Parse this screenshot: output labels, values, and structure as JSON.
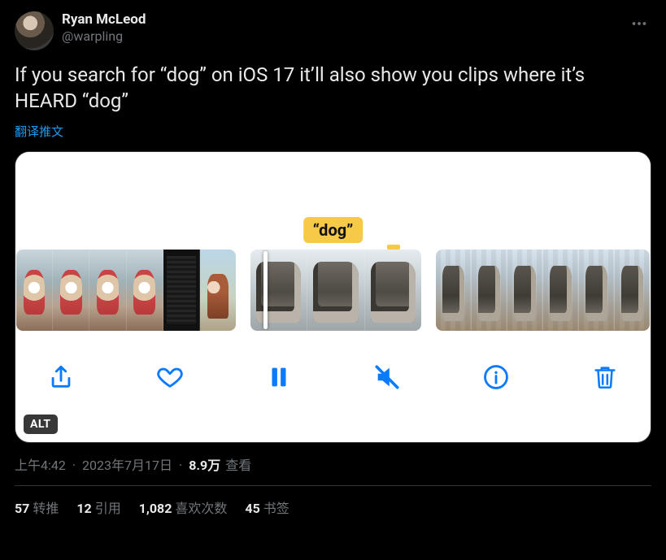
{
  "author": {
    "display_name": "Ryan McLeod",
    "handle": "@warpling"
  },
  "tweet_text": "If you search for “dog” on iOS 17 it’ll also show you clips where it’s HEARD “dog”",
  "translate_label": "翻译推文",
  "media": {
    "search_chip": "“dog”",
    "alt_badge": "ALT"
  },
  "meta": {
    "time": "上午4:42",
    "date": "2023年7月17日",
    "views_value": "8.9万",
    "views_label": "查看"
  },
  "stats": {
    "retweets_value": "57",
    "retweets_label": "转推",
    "quotes_value": "12",
    "quotes_label": "引用",
    "likes_value": "1,082",
    "likes_label": "喜欢次数",
    "bookmarks_value": "45",
    "bookmarks_label": "书签"
  }
}
